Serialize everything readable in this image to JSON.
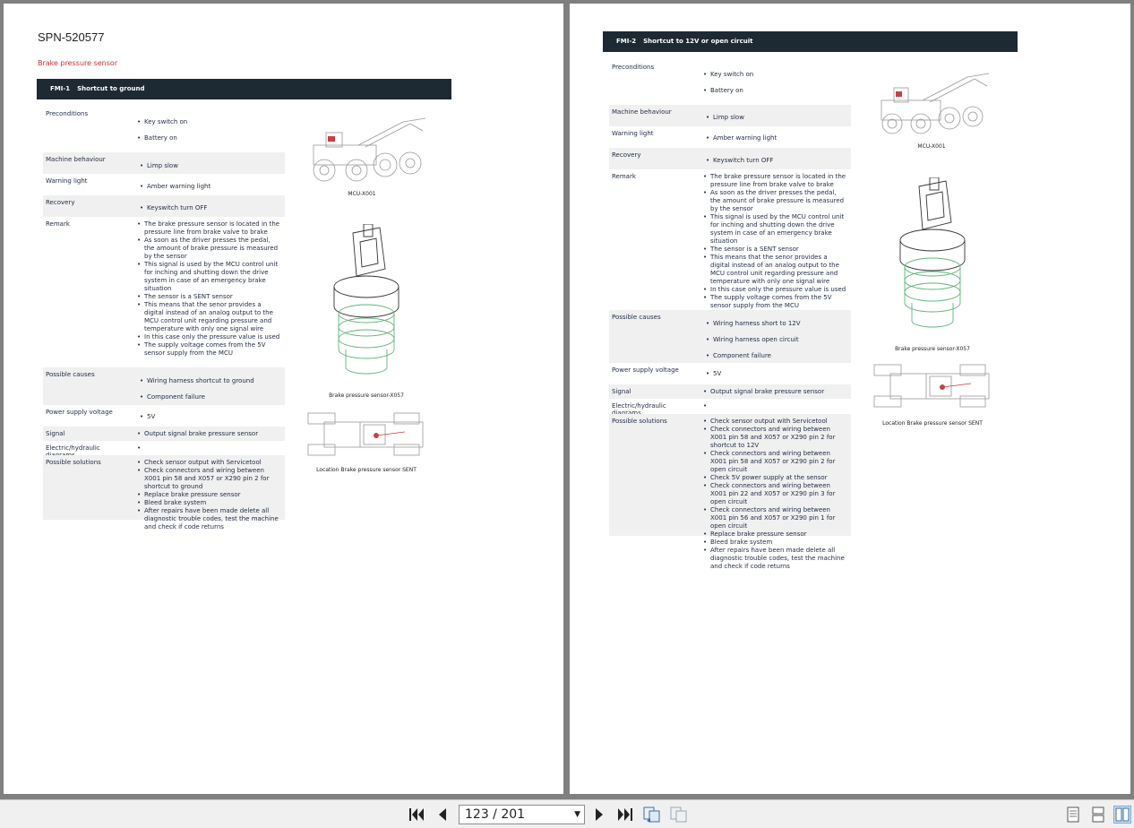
{
  "left_page": {
    "title": "SPN-520577",
    "subtitle": "Brake pressure sensor",
    "fmi": {
      "code": "FMI-1",
      "label": "Shortcut to ground"
    },
    "rows": [
      {
        "label": "Preconditions",
        "items": [
          "Key switch on",
          "Battery on"
        ]
      },
      {
        "label": "Machine behaviour",
        "items": [
          "Limp slow"
        ]
      },
      {
        "label": "Warning light",
        "items": [
          "Amber warning light"
        ]
      },
      {
        "label": "Recovery",
        "items": [
          "Keyswitch turn OFF"
        ]
      },
      {
        "label": "Remark",
        "items": [
          "The brake pressure sensor is located in the pressure line from brake valve to brake",
          "As soon as the driver presses the pedal, the amount of brake pressure is measured by the sensor",
          "This signal is used by the MCU control unit for inching and shutting down the drive system in case of an emergency brake situation",
          "The sensor is a SENT sensor",
          "This means that the senor provides a digital instead of an analog output to the MCU control unit regarding pressure and temperature with only one signal wire",
          "In this case only the pressure value is used",
          "The supply voltage comes from the 5V sensor supply from the MCU"
        ]
      },
      {
        "label": "Possible causes",
        "items": [
          "Wiring harness shortcut to ground",
          "Component failure"
        ]
      },
      {
        "label": "Power supply voltage",
        "items": [
          "5V"
        ]
      },
      {
        "label": "Signal",
        "items": [
          "Output signal brake pressure sensor"
        ]
      },
      {
        "label": "Electric/hydraulic diagrams",
        "items": [
          ""
        ]
      },
      {
        "label": "Possible solutions",
        "items": [
          "Check sensor output with Servicetool",
          "Check connectors and wiring between X001 pin 58 and X057 or X290 pin 2 for shortcut to ground",
          "Replace brake pressure sensor",
          "Bleed brake system",
          "After repairs have been made delete all diagnostic trouble codes, test the machine and check if code returns"
        ]
      }
    ],
    "captions": {
      "machine": "MCU-X001",
      "sensor": "Brake pressure sensor-X057",
      "location": "Location Brake pressure sensor SENT"
    }
  },
  "right_page": {
    "fmi": {
      "code": "FMI-2",
      "label": "Shortcut to 12V or open circuit"
    },
    "rows": [
      {
        "label": "Preconditions",
        "items": [
          "Key switch on",
          "Battery on"
        ]
      },
      {
        "label": "Machine behaviour",
        "items": [
          "Limp slow"
        ]
      },
      {
        "label": "Warning light",
        "items": [
          "Amber warning light"
        ]
      },
      {
        "label": "Recovery",
        "items": [
          "Keyswitch turn OFF"
        ]
      },
      {
        "label": "Remark",
        "items": [
          "The brake pressure sensor is located in the pressure line from brake valve to brake",
          "As soon as the driver presses the pedal, the amount of brake pressure is measured by the sensor",
          "This signal is used by the MCU control unit for inching and shutting down the drive system in case of an emergency brake situation",
          "The sensor is a SENT sensor",
          "This means that the senor provides a digital instead of an analog output to the MCU control unit regarding pressure and temperature with only one signal wire",
          "In this case only the pressure value is used",
          "The supply voltage comes from the 5V sensor supply from the MCU"
        ]
      },
      {
        "label": "Possible causes",
        "items": [
          "Wiring harness short to 12V",
          "Wiring harness open circuit",
          "Component failure"
        ]
      },
      {
        "label": "Power supply voltage",
        "items": [
          "5V"
        ]
      },
      {
        "label": "Signal",
        "items": [
          "Output signal brake pressure sensor"
        ]
      },
      {
        "label": "Electric/hydraulic diagrams",
        "items": [
          ""
        ]
      },
      {
        "label": "Possible solutions",
        "items": [
          "Check sensor output with Servicetool",
          "Check connectors and wiring between X001 pin 58 and X057 or X290 pin 2 for shortcut to 12V",
          "Check connectors and wiring between X001 pin 58 and X057 or X290 pin 2 for open circuit",
          "Check 5V power supply at the sensor",
          "Check connectors and wiring between X001 pin 22 and X057 or X290 pin 3 for open circuit",
          "Check connectors and wiring between X001 pin 56 and X057 or X290 pin 1 for open circuit",
          "Replace brake pressure sensor",
          "Bleed brake system",
          "After repairs have been made delete all diagnostic trouble codes, test the machine and check if code returns"
        ]
      }
    ],
    "captions": {
      "machine": "MCU-X001",
      "sensor": "Brake pressure sensor-X057",
      "location": "Location Brake pressure sensor SENT"
    }
  },
  "toolbar": {
    "page_indicator": "123 / 201",
    "icons": [
      "first-page-icon",
      "previous-page-icon",
      "next-page-icon",
      "last-page-icon",
      "rotate-pages-icon",
      "compare-pages-icon",
      "single-page-view-icon",
      "continuous-view-icon",
      "two-page-view-icon"
    ]
  },
  "colors": {
    "header_bar": "#1d2a34",
    "subtitle_red": "#d03030",
    "shaded_row": "#f0f0f0",
    "background": "#808080"
  }
}
